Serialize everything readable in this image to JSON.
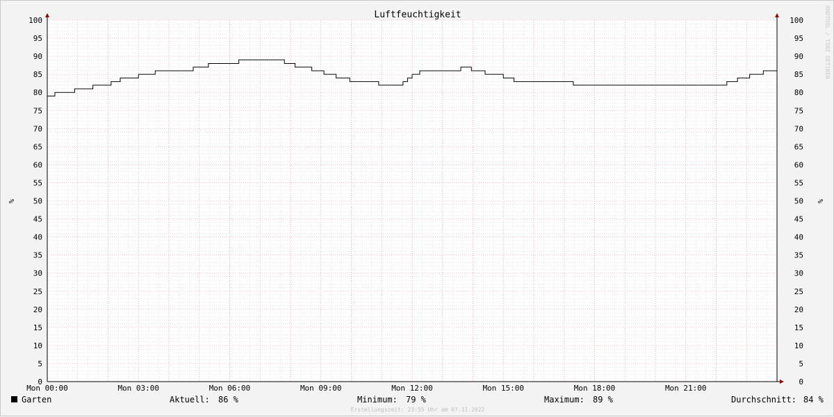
{
  "chart_data": {
    "type": "line",
    "title": "Luftfeuchtigkeit",
    "ylabel": "%",
    "ylabel_right": "%",
    "ylim": [
      0,
      100
    ],
    "yticks": [
      0,
      5,
      10,
      15,
      20,
      25,
      30,
      35,
      40,
      45,
      50,
      55,
      60,
      65,
      70,
      75,
      80,
      85,
      90,
      95,
      100
    ],
    "xlim_hours": [
      0,
      24
    ],
    "xticks": [
      {
        "hour": 0,
        "label": "Mon 00:00"
      },
      {
        "hour": 3,
        "label": "Mon 03:00"
      },
      {
        "hour": 6,
        "label": "Mon 06:00"
      },
      {
        "hour": 9,
        "label": "Mon 09:00"
      },
      {
        "hour": 12,
        "label": "Mon 12:00"
      },
      {
        "hour": 15,
        "label": "Mon 15:00"
      },
      {
        "hour": 18,
        "label": "Mon 18:00"
      },
      {
        "hour": 21,
        "label": "Mon 21:00"
      }
    ],
    "grid": true,
    "series": [
      {
        "name": "Garten",
        "color": "#000000",
        "step": true,
        "x": [
          0,
          0.25,
          0.9,
          1.5,
          2.1,
          2.4,
          3.0,
          3.55,
          4.8,
          5.3,
          6.3,
          7.8,
          8.15,
          8.7,
          9.1,
          9.5,
          9.95,
          10.9,
          11.7,
          11.85,
          12.0,
          12.25,
          13.6,
          13.95,
          14.4,
          15.0,
          15.35,
          17.3,
          22.15,
          22.35,
          22.7,
          23.1,
          23.55,
          24.0
        ],
        "values": [
          79,
          80,
          81,
          82,
          83,
          84,
          85,
          86,
          87,
          88,
          89,
          88,
          87,
          86,
          85,
          84,
          83,
          82,
          83,
          84,
          85,
          86,
          87,
          86,
          85,
          84,
          83,
          82,
          82,
          83,
          84,
          85,
          86,
          86
        ]
      }
    ]
  },
  "side_label": "RRDTOOL / TOBI OETIKER",
  "legend": {
    "series_name": "Garten",
    "swatch_color": "#000000",
    "current_label": "Aktuell:",
    "current_value": "86 %",
    "min_label": "Minimum:",
    "min_value": "79 %",
    "max_label": "Maximum:",
    "max_value": "89 %",
    "avg_label": "Durchschnitt:",
    "avg_value": "84 %"
  },
  "footer": "Erstellungszeit: 23:55 Uhr am 07.11.2022",
  "colors": {
    "background": "#f3f3f3",
    "plot_background": "#ffffff",
    "major_grid": "#e8a0a8",
    "minor_grid": "#d0d0d0",
    "axis": "#000000",
    "arrow": "#8b0000"
  }
}
